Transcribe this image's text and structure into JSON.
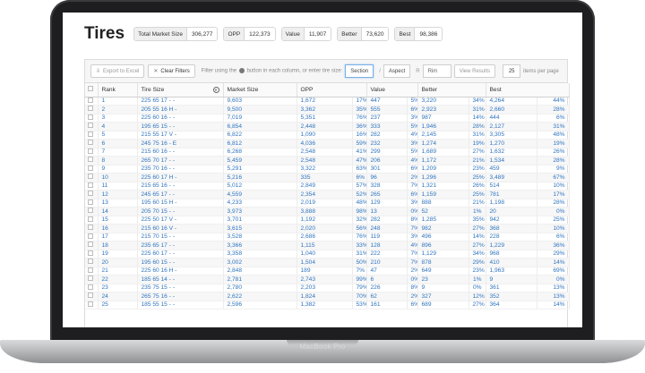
{
  "device": {
    "brand": "MacBook Pro"
  },
  "app": {
    "title": "Tires",
    "stats": [
      {
        "label": "Total Market Size",
        "value": "306,277"
      },
      {
        "label": "OPP",
        "value": "122,373"
      },
      {
        "label": "Value",
        "value": "11,907"
      },
      {
        "label": "Better",
        "value": "73,620"
      },
      {
        "label": "Best",
        "value": "98,386"
      }
    ]
  },
  "toolbar": {
    "export_label": "Export to Excel",
    "clear_label": "Clear Filters",
    "hint_before": "Filter using the",
    "hint_after": "button in each column, or enter tire size:",
    "section_placeholder": "Section",
    "slash": "/",
    "aspect_placeholder": "Aspect",
    "r_label": "R",
    "rim_placeholder": "Rim",
    "view_label": "View Results",
    "per_page_value": "25",
    "per_page_label": "items per page"
  },
  "table": {
    "headers": [
      "Rank",
      "Tire Size",
      "Market Size",
      "OPP",
      "Value",
      "Better",
      "Best"
    ],
    "rows": [
      [
        "1",
        "225 65 17 - -",
        "9,603",
        "1,672",
        "17%",
        "447",
        "5%",
        "3,220",
        "34%",
        "4,264",
        "44%"
      ],
      [
        "2",
        "205 55 16 H -",
        "9,500",
        "3,362",
        "35%",
        "555",
        "6%",
        "2,923",
        "31%",
        "2,660",
        "28%"
      ],
      [
        "3",
        "225 60 16 - -",
        "7,019",
        "5,351",
        "76%",
        "237",
        "3%",
        "987",
        "14%",
        "444",
        "6%"
      ],
      [
        "4",
        "195 65 15 - -",
        "6,854",
        "2,448",
        "36%",
        "333",
        "5%",
        "1,946",
        "28%",
        "2,127",
        "31%"
      ],
      [
        "5",
        "215 55 17 V -",
        "6,822",
        "1,090",
        "16%",
        "282",
        "4%",
        "2,145",
        "31%",
        "3,305",
        "48%"
      ],
      [
        "6",
        "245 75 16 - E",
        "6,812",
        "4,036",
        "59%",
        "232",
        "3%",
        "1,274",
        "19%",
        "1,270",
        "19%"
      ],
      [
        "7",
        "215 60 16 - -",
        "6,268",
        "2,548",
        "41%",
        "299",
        "5%",
        "1,689",
        "27%",
        "1,632",
        "26%"
      ],
      [
        "8",
        "265 70 17 - -",
        "5,459",
        "2,548",
        "47%",
        "206",
        "4%",
        "1,172",
        "21%",
        "1,534",
        "28%"
      ],
      [
        "9",
        "235 70 16 - -",
        "5,291",
        "3,322",
        "63%",
        "301",
        "6%",
        "1,209",
        "23%",
        "459",
        "9%"
      ],
      [
        "10",
        "225 60 17 H -",
        "5,216",
        "335",
        "6%",
        "96",
        "2%",
        "1,296",
        "25%",
        "3,489",
        "67%"
      ],
      [
        "11",
        "215 65 16 - -",
        "5,012",
        "2,849",
        "57%",
        "328",
        "7%",
        "1,321",
        "26%",
        "514",
        "10%"
      ],
      [
        "12",
        "245 65 17 - -",
        "4,559",
        "2,354",
        "52%",
        "265",
        "6%",
        "1,159",
        "25%",
        "781",
        "17%"
      ],
      [
        "13",
        "195 60 15 H -",
        "4,233",
        "2,019",
        "48%",
        "129",
        "3%",
        "888",
        "21%",
        "1,198",
        "28%"
      ],
      [
        "14",
        "205 70 15 - -",
        "3,973",
        "3,888",
        "98%",
        "13",
        "0%",
        "52",
        "1%",
        "20",
        "0%"
      ],
      [
        "15",
        "225 50 17 V -",
        "3,701",
        "1,192",
        "32%",
        "282",
        "8%",
        "1,285",
        "35%",
        "942",
        "25%"
      ],
      [
        "16",
        "215 60 16 V -",
        "3,615",
        "2,020",
        "56%",
        "248",
        "7%",
        "982",
        "27%",
        "368",
        "10%"
      ],
      [
        "17",
        "215 70 15 - -",
        "3,528",
        "2,686",
        "76%",
        "119",
        "3%",
        "496",
        "14%",
        "228",
        "6%"
      ],
      [
        "18",
        "235 65 17 - -",
        "3,366",
        "1,115",
        "33%",
        "128",
        "4%",
        "896",
        "27%",
        "1,229",
        "36%"
      ],
      [
        "19",
        "225 60 17 - -",
        "3,358",
        "1,040",
        "31%",
        "222",
        "7%",
        "1,129",
        "34%",
        "968",
        "29%"
      ],
      [
        "20",
        "195 60 15 - -",
        "3,002",
        "1,504",
        "50%",
        "210",
        "7%",
        "878",
        "29%",
        "410",
        "14%"
      ],
      [
        "21",
        "225 60 16 H -",
        "2,848",
        "189",
        "7%",
        "47",
        "2%",
        "649",
        "23%",
        "1,963",
        "69%"
      ],
      [
        "22",
        "185 65 14 - -",
        "2,781",
        "2,743",
        "99%",
        "6",
        "0%",
        "23",
        "1%",
        "9",
        "0%"
      ],
      [
        "23",
        "235 75 15 - -",
        "2,780",
        "2,203",
        "79%",
        "226",
        "8%",
        "9",
        "0%",
        "361",
        "13%"
      ],
      [
        "24",
        "265 75 16 - -",
        "2,622",
        "1,824",
        "70%",
        "62",
        "2%",
        "327",
        "12%",
        "352",
        "13%"
      ],
      [
        "25",
        "185 55 15 - -",
        "2,596",
        "1,382",
        "53%",
        "161",
        "6%",
        "689",
        "27%",
        "364",
        "14%"
      ]
    ]
  }
}
